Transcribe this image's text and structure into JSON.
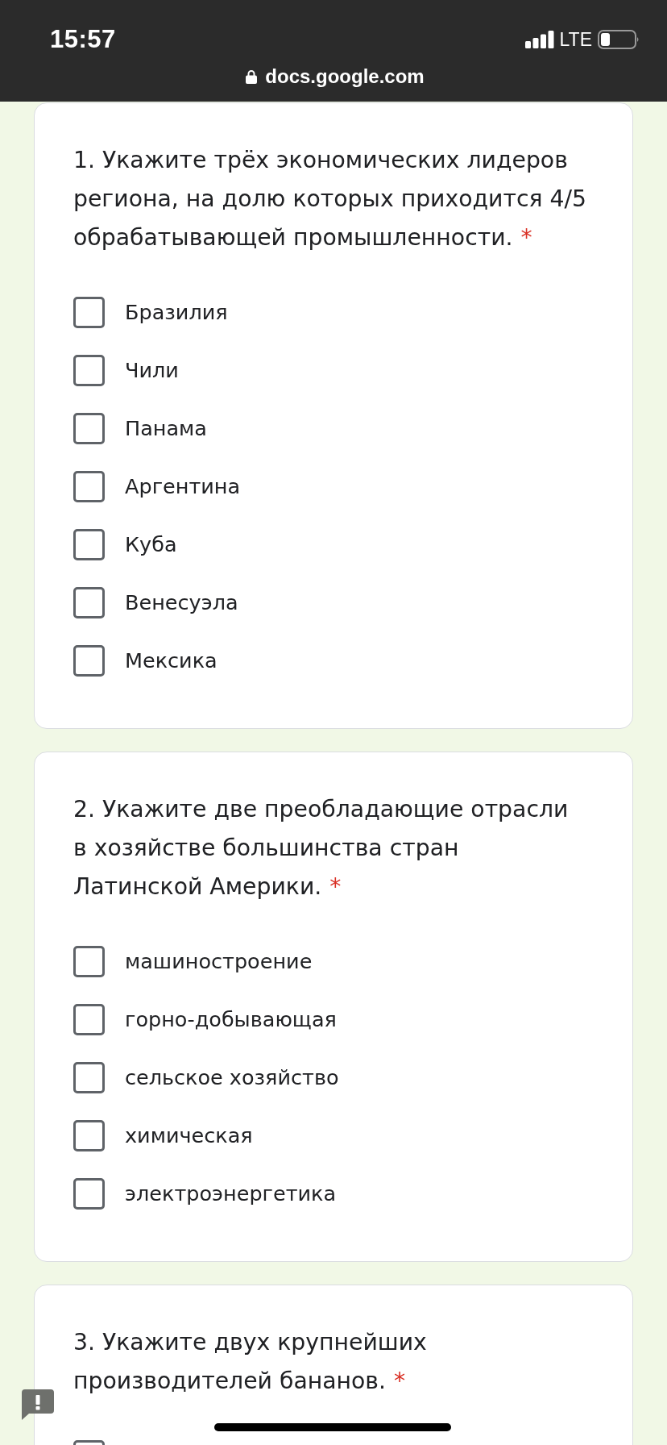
{
  "status_bar": {
    "time": "15:57",
    "network": "LTE",
    "url": "docs.google.com"
  },
  "questions": [
    {
      "text": "1. Укажите трёх экономических лидеров региона, на долю которых приходится 4/5 обрабатывающей промышленности.",
      "required_mark": "*",
      "options": [
        {
          "label": "Бразилия",
          "checked": false
        },
        {
          "label": "Чили",
          "checked": false
        },
        {
          "label": "Панама",
          "checked": false
        },
        {
          "label": "Аргентина",
          "checked": false
        },
        {
          "label": "Куба",
          "checked": false
        },
        {
          "label": "Венесуэла",
          "checked": false
        },
        {
          "label": "Мексика",
          "checked": false
        }
      ]
    },
    {
      "text": "2. Укажите две преобладающие отрасли в хозяйстве большинства стран Латинской Америки.",
      "required_mark": "*",
      "options": [
        {
          "label": "машиностроение",
          "checked": false
        },
        {
          "label": "горно-добывающая",
          "checked": false
        },
        {
          "label": "сельское хозяйство",
          "checked": false
        },
        {
          "label": "химическая",
          "checked": false
        },
        {
          "label": "электроэнергетика",
          "checked": false
        }
      ]
    },
    {
      "text": "3. Укажите двух крупнейших производителей бананов.",
      "required_mark": "*",
      "options": [
        {
          "checked": false
        }
      ]
    }
  ]
}
